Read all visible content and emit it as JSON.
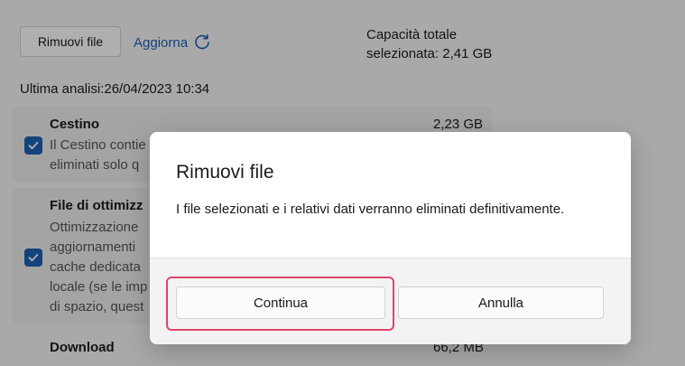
{
  "toolbar": {
    "remove_label": "Rimuovi file",
    "refresh_label": "Aggiorna"
  },
  "summary": {
    "capacity_line1": "Capacità totale",
    "capacity_line2": "selezionata: 2,41 GB",
    "last_scan": "Ultima analisi:26/04/2023 10:34"
  },
  "items": [
    {
      "title": "Cestino",
      "size": "2,23 GB",
      "checked": true,
      "desc_lines": [
        "Il Cestino contie",
        "eliminati solo q"
      ]
    },
    {
      "title": "File di ottimizz",
      "size": "",
      "checked": true,
      "desc_lines": [
        "Ottimizzazione",
        "aggiornamenti",
        "cache dedicata",
        "locale (se le imp",
        "di spazio, quest"
      ]
    },
    {
      "title": "Download",
      "size": "66,2 MB",
      "checked": false,
      "desc_lines": []
    }
  ],
  "dialog": {
    "title": "Rimuovi file",
    "message": "I file selezionati e i relativi dati verranno eliminati definitivamente.",
    "continue_label": "Continua",
    "cancel_label": "Annulla"
  },
  "colors": {
    "accent": "#1d5fb0",
    "highlight": "#e0456a"
  }
}
